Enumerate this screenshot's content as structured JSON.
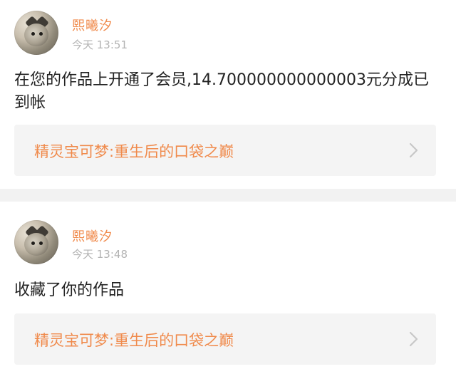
{
  "notifications": [
    {
      "user": {
        "name": "熙曦汐"
      },
      "time": "今天 13:51",
      "message": "在您的作品上开通了会员,14.700000000000003元分成已到帐",
      "link": {
        "title": "精灵宝可梦:重生后的口袋之巅",
        "icon": "chevron-right-icon"
      }
    },
    {
      "user": {
        "name": "熙曦汐"
      },
      "time": "今天 13:48",
      "message": "收藏了你的作品",
      "link": {
        "title": "精灵宝可梦:重生后的口袋之巅",
        "icon": "chevron-right-icon"
      }
    }
  ],
  "colors": {
    "accent": "#f08a4b",
    "text": "#222222",
    "muted": "#b3b3b3",
    "link_bg": "#f4f4f4",
    "separator": "#f2f2f2"
  }
}
